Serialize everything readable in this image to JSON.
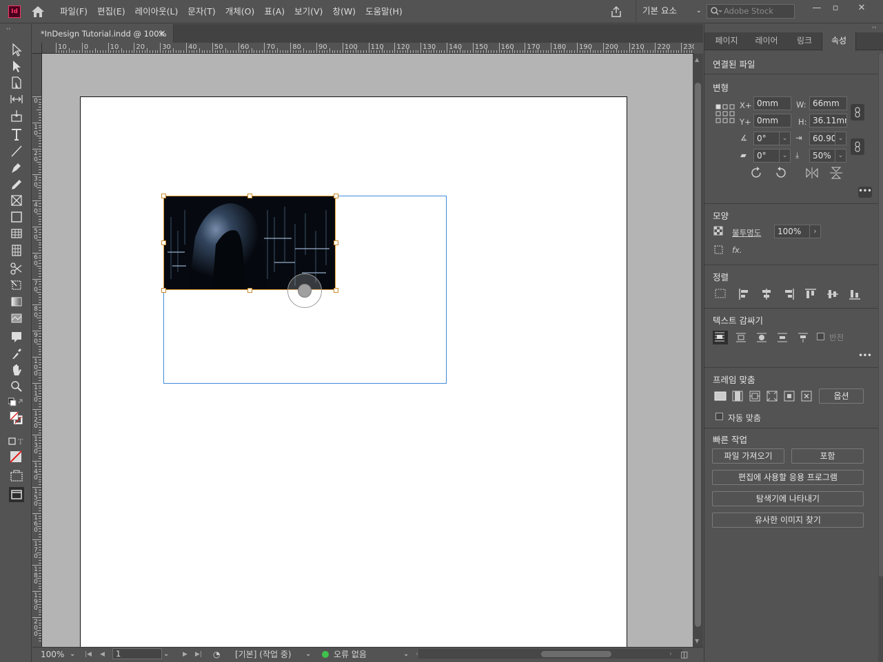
{
  "app": {
    "logo_text": "Id"
  },
  "menu": {
    "items": [
      "파일(F)",
      "편집(E)",
      "레이아웃(L)",
      "문자(T)",
      "개체(O)",
      "표(A)",
      "보기(V)",
      "창(W)",
      "도움말(H)"
    ]
  },
  "header": {
    "workspace_label": "기본 요소",
    "stock_search_placeholder": "Adobe Stock"
  },
  "document": {
    "tab_title": "*InDesign Tutorial.indd @ 100%",
    "close_label": "×"
  },
  "rulers": {
    "horizontal": [
      "10",
      "0",
      "10",
      "20",
      "30",
      "40",
      "50",
      "60",
      "70",
      "80",
      "90",
      "100",
      "110",
      "120",
      "130",
      "140",
      "150",
      "160",
      "170",
      "180",
      "190",
      "200",
      "210",
      "220",
      "230"
    ],
    "vertical": [
      "0",
      "10",
      "20",
      "30",
      "40",
      "50",
      "60",
      "70",
      "80",
      "90",
      "100",
      "110",
      "120",
      "130",
      "140",
      "150",
      "160",
      "170",
      "180",
      "190",
      "200"
    ]
  },
  "status": {
    "zoom": "100%",
    "page": "1",
    "preflight_profile": "[기본] (작업 중)",
    "errors": "오류 없음"
  },
  "panel": {
    "tabs": [
      "페이지",
      "레이어",
      "링크",
      "속성"
    ],
    "active_tab": "속성",
    "section_linked": "연결된 파일",
    "transform": {
      "title": "변형",
      "x_label": "X+",
      "x_value": "0mm",
      "y_label": "Y+",
      "y_value": "0mm",
      "w_label": "W:",
      "w_value": "66mm",
      "h_label": "H:",
      "h_value": "36.11mr",
      "rotation": "0°",
      "shear": "0°",
      "scale_x": "60.90",
      "scale_y": "50%"
    },
    "appearance": {
      "title": "모양",
      "opacity_label": "불투명도",
      "opacity_value": "100%",
      "fx_label": "fx."
    },
    "align": {
      "title": "정렬"
    },
    "text_wrap": {
      "title": "텍스트 감싸기",
      "invert_label": "반전"
    },
    "frame_fitting": {
      "title": "프레임 맞춤",
      "options_label": "옵션",
      "auto_fit_label": "자동 맞춤"
    },
    "quick_actions": {
      "title": "빠른 작업",
      "import_label": "파일 가져오기",
      "embed_label": "포함",
      "edit_with_label": "편집에 사용할 응용 프로그램",
      "reveal_label": "탐색기에 나타내기",
      "similar_label": "유사한 이미지 찾기"
    }
  },
  "colors": {
    "accent_blue": "#3f8ad8",
    "frame_orange": "#e8a33a",
    "status_ok": "#3ec24c"
  }
}
